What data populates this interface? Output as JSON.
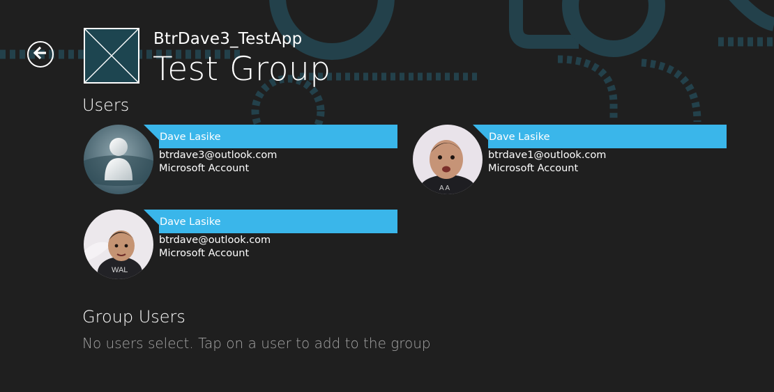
{
  "header": {
    "app_name": "BtrDave3_TestApp",
    "page_title": "Test Group",
    "back_icon": "back-arrow-icon",
    "logo_icon": "placeholder-logo-icon"
  },
  "users_section": {
    "heading": "Users",
    "cards": [
      {
        "name": "Dave Lasike",
        "email": "btrdave3@outlook.com",
        "account_type": "Microsoft Account",
        "avatar": "default-person-avatar"
      },
      {
        "name": "Dave Lasike",
        "email": "btrdave1@outlook.com",
        "account_type": "Microsoft Account",
        "avatar": "baby-photo-avatar"
      },
      {
        "name": "Dave Lasike",
        "email": "btrdave@outlook.com",
        "account_type": "Microsoft Account",
        "avatar": "baby-photo-avatar"
      }
    ]
  },
  "group_users_section": {
    "heading": "Group Users",
    "empty_message": "No users select. Tap on a user to add to the group"
  },
  "colors": {
    "background": "#1f1f1f",
    "accent": "#3ab6ea",
    "decoration": "#23414b",
    "muted_text": "#a6a6a6"
  }
}
